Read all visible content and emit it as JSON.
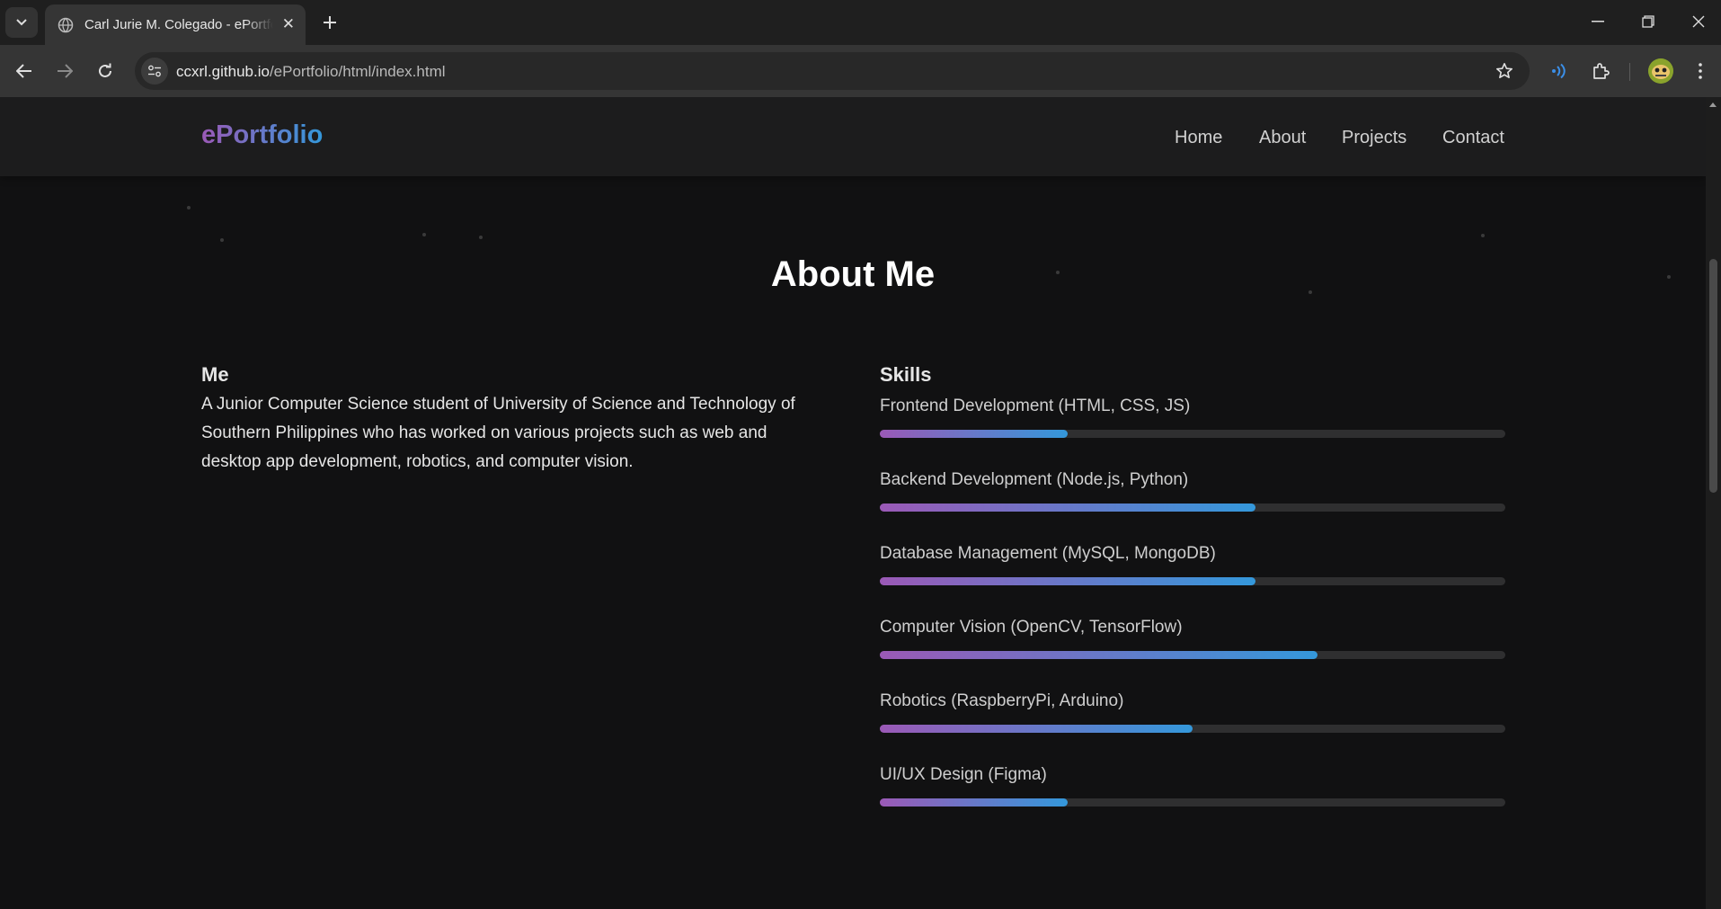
{
  "browser": {
    "tab": {
      "title": "Carl Jurie M. Colegado - ePortfolio"
    },
    "address_bar": {
      "host": "ccxrl.github.io",
      "path": "/ePortfolio/html/index.html"
    },
    "icons": [
      "tab-search-icon",
      "globe-icon",
      "close-icon",
      "plus-icon",
      "minimize-icon",
      "restore-icon",
      "back-icon",
      "forward-icon",
      "reload-icon",
      "site-info-icon",
      "star-icon",
      "read-aloud-icon",
      "extensions-icon",
      "more-icon"
    ]
  },
  "site": {
    "brand": "ePortfolio",
    "nav": [
      "Home",
      "About",
      "Projects",
      "Contact"
    ],
    "colors": {
      "gradient_start": "#9b59b6",
      "gradient_end": "#3498db",
      "background": "#111112"
    }
  },
  "about": {
    "title": "About Me",
    "me_heading": "Me",
    "me_text": "A Junior Computer Science student of University of Science and Technology of Southern Philippines who has worked on various projects such as web and desktop app development, robotics, and computer vision.",
    "skills_heading": "Skills",
    "skills": [
      {
        "label": "Frontend Development (HTML, CSS, JS)",
        "level": 0.3
      },
      {
        "label": "Backend Development (Node.js, Python)",
        "level": 0.6
      },
      {
        "label": "Database Management (MySQL, MongoDB)",
        "level": 0.6
      },
      {
        "label": "Computer Vision (OpenCV, TensorFlow)",
        "level": 0.7
      },
      {
        "label": "Robotics (RaspberryPi, Arduino)",
        "level": 0.5
      },
      {
        "label": "UI/UX Design (Figma)",
        "level": 0.3
      }
    ]
  }
}
